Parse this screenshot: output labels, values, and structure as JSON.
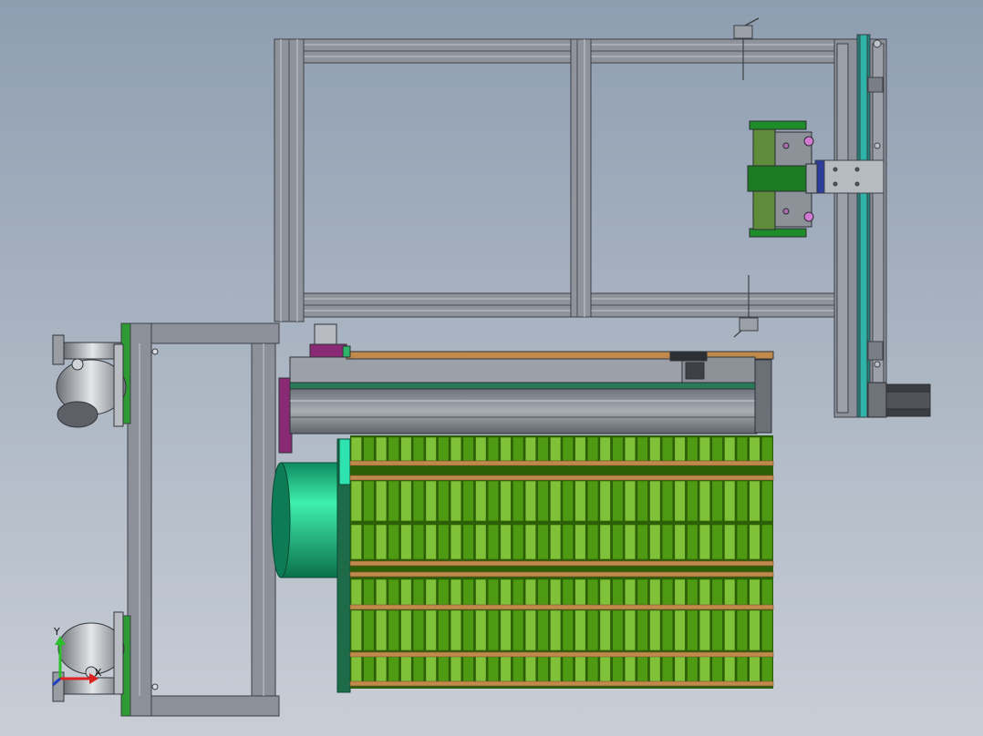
{
  "view": {
    "background_top": "#8e9eb1",
    "background_bottom": "#c9ced6"
  },
  "colors": {
    "frame": "#8b9099",
    "frame_dark": "#4a4e55",
    "frame_light": "#c3c7cd",
    "belt": "#2fb3a8",
    "green_cell": "#4e9a12",
    "green_cell_dark": "#2d5e08",
    "green_cell_light": "#7fc23a",
    "rod": "#c08a4c",
    "motor": "#1fcf8e",
    "magenta_plate": "#8a2a75",
    "bracket_green": "#1f8c2a",
    "bracket_blue": "#2d3d9b",
    "wheel": "#a9adb3"
  },
  "triad": {
    "x_label": "X",
    "y_label": "Y"
  },
  "components": [
    {
      "name": "upper-frame",
      "icon": "aluminum-profile-frame"
    },
    {
      "name": "vertical-belt-axis",
      "icon": "belt-drive"
    },
    {
      "name": "gripper-assembly",
      "icon": "gripper"
    },
    {
      "name": "servo-motor",
      "icon": "stepper-motor"
    },
    {
      "name": "linear-module",
      "icon": "linear-slide"
    },
    {
      "name": "battery-tray",
      "icon": "cell-array"
    },
    {
      "name": "cart-frame",
      "icon": "cart"
    },
    {
      "name": "caster-wheels",
      "icon": "caster"
    }
  ]
}
